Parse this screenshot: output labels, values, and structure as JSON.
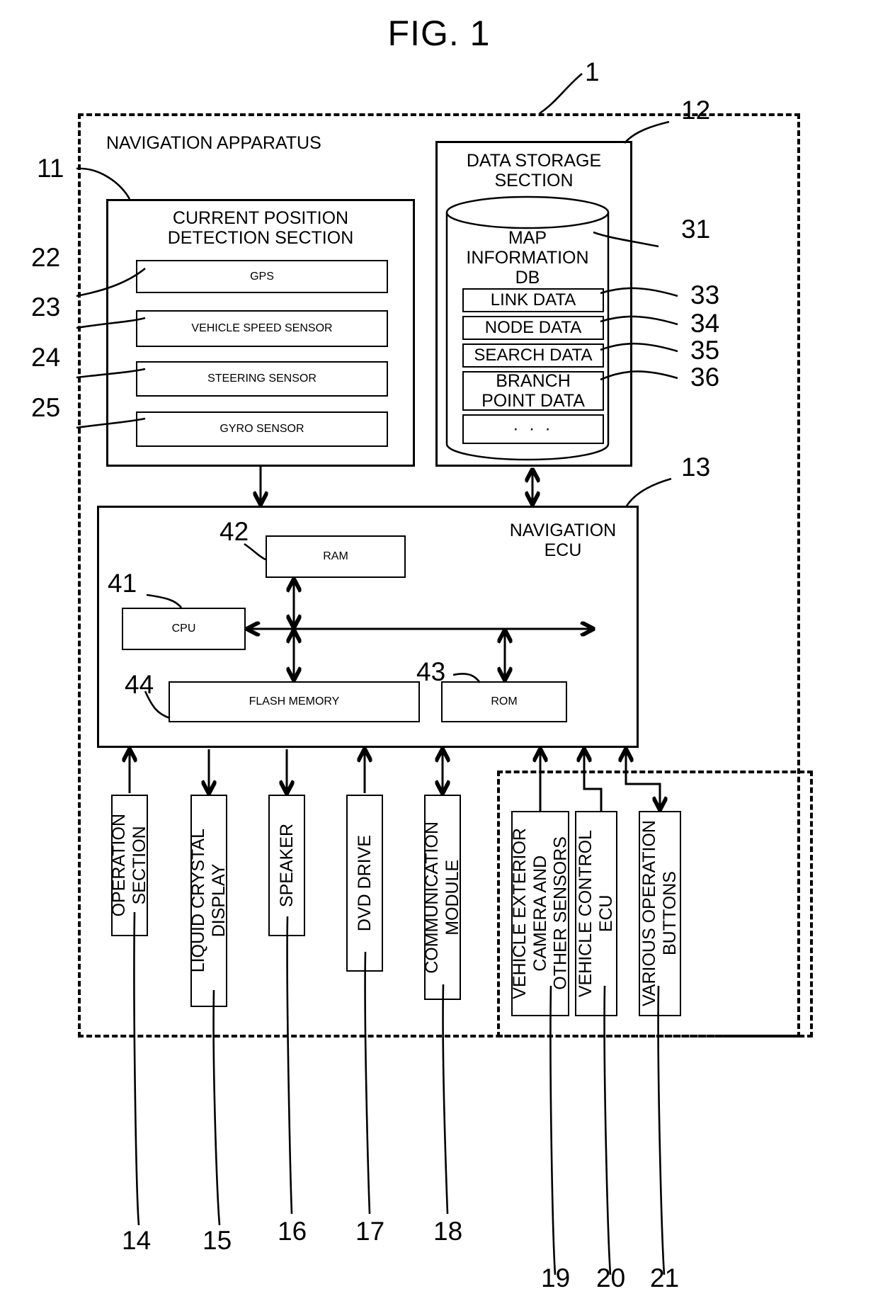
{
  "figure": {
    "title": "FIG. 1",
    "system_ref": "1"
  },
  "outer": {
    "label": "NAVIGATION APPARATUS",
    "ref": "11"
  },
  "current_position_section": {
    "title": "CURRENT POSITION\nDETECTION SECTION",
    "items": [
      {
        "label": "GPS",
        "ref": "22"
      },
      {
        "label": "VEHICLE SPEED SENSOR",
        "ref": "23"
      },
      {
        "label": "STEERING SENSOR",
        "ref": "24"
      },
      {
        "label": "GYRO SENSOR",
        "ref": "25"
      }
    ]
  },
  "data_storage_section": {
    "title": "DATA STORAGE\nSECTION",
    "ref": "12",
    "database": {
      "label": "MAP\nINFORMATION\nDB",
      "ref": "31",
      "rows": [
        {
          "label": "LINK DATA",
          "ref": "33"
        },
        {
          "label": "NODE DATA",
          "ref": "34"
        },
        {
          "label": "SEARCH DATA",
          "ref": "35"
        },
        {
          "label": "BRANCH\nPOINT DATA",
          "ref": "36"
        },
        {
          "label": "· · ·",
          "ref": ""
        }
      ]
    }
  },
  "navigation_ecu": {
    "title": "NAVIGATION\nECU",
    "ref": "13",
    "components": [
      {
        "label": "RAM",
        "ref": "42"
      },
      {
        "label": "CPU",
        "ref": "41"
      },
      {
        "label": "FLASH MEMORY",
        "ref": "44"
      },
      {
        "label": "ROM",
        "ref": "43"
      }
    ]
  },
  "peripherals": [
    {
      "label": "OPERATION\nSECTION",
      "ref": "14"
    },
    {
      "label": "LIQUID CRYSTAL\nDISPLAY",
      "ref": "15"
    },
    {
      "label": "SPEAKER",
      "ref": "16"
    },
    {
      "label": "DVD DRIVE",
      "ref": "17"
    },
    {
      "label": "COMMUNICATION\nMODULE",
      "ref": "18"
    }
  ],
  "external_units": [
    {
      "label": "VEHICLE EXTERIOR\nCAMERA AND\nOTHER SENSORS",
      "ref": "19"
    },
    {
      "label": "VEHICLE CONTROL\nECU",
      "ref": "20"
    },
    {
      "label": "VARIOUS OPERATION\nBUTTONS",
      "ref": "21"
    }
  ]
}
